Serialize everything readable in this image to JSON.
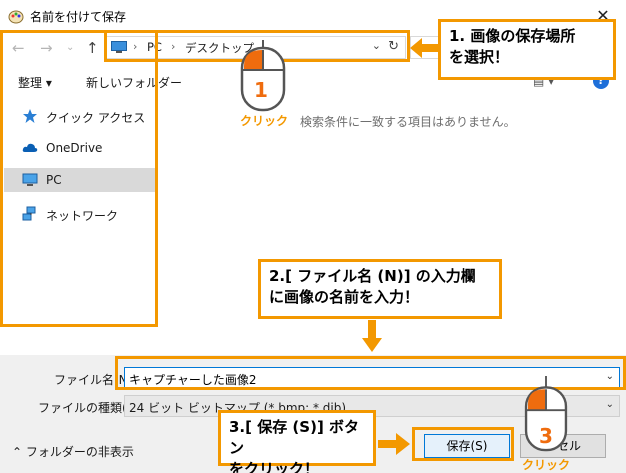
{
  "window": {
    "title": "名前を付けて保存",
    "close_glyph": "✕"
  },
  "address": {
    "segment1": "PC",
    "segment2": "デスクトップ",
    "separator": "›",
    "search_placeholder": ""
  },
  "toolbar": {
    "organize": "整理 ▾",
    "new_folder": "新しいフォルダー",
    "help": "?"
  },
  "sidebar": {
    "items": [
      {
        "label": "クイック アクセス",
        "icon": "star-icon"
      },
      {
        "label": "OneDrive",
        "icon": "cloud-icon"
      },
      {
        "label": "PC",
        "icon": "computer-icon",
        "selected": true
      },
      {
        "label": "ネットワーク",
        "icon": "network-icon"
      }
    ]
  },
  "main": {
    "empty_message": "検索条件に一致する項目はありません。"
  },
  "form": {
    "filename_label": "ファイル名(N",
    "filename_value": "キャプチャーした画像2",
    "filetype_label": "ファイルの種類(T):",
    "filetype_value": "24 ビット ビットマップ (*.bmp; *.dib)",
    "hide_folders": "フォルダーの非表示",
    "save_button": "保存(S)",
    "cancel_button": "ンセル"
  },
  "annotations": {
    "step1": "1. 画像の保存場所\nを選択！",
    "step2": "2.[ ファイル名 (N)] の入力欄\nに画像の名前を入力！",
    "step3": "3.[ 保存 (S)] ボタン\nをクリック！",
    "mouse1_number": "1",
    "mouse3_number": "3",
    "click_label": "クリック",
    "accent_color": "#f39800"
  }
}
